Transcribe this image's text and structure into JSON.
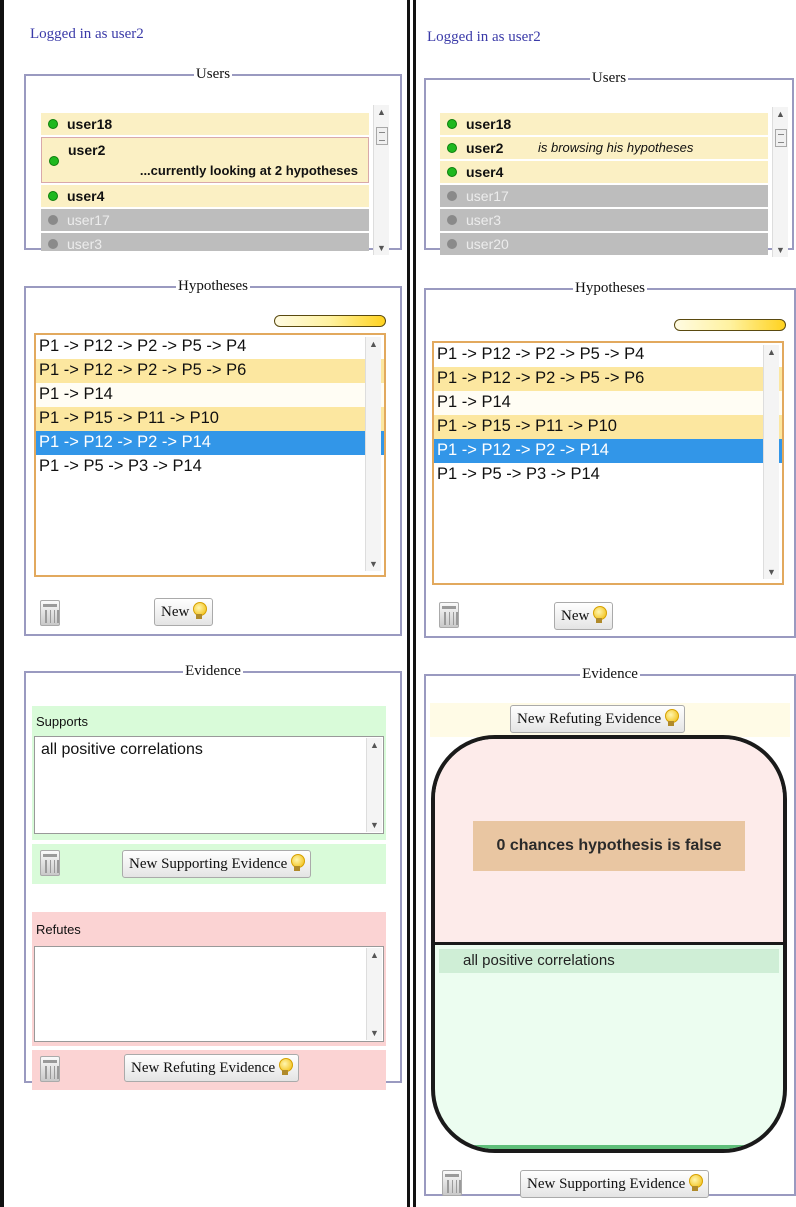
{
  "left": {
    "login": "Logged in as user2",
    "users": {
      "legend": "Users",
      "list": [
        {
          "name": "user18",
          "online": true,
          "status": ""
        },
        {
          "name": "user2",
          "online": true,
          "status": "...currently looking at 2 hypotheses"
        },
        {
          "name": "user4",
          "online": true,
          "status": ""
        },
        {
          "name": "user17",
          "online": false,
          "status": ""
        },
        {
          "name": "user3",
          "online": false,
          "status": ""
        }
      ]
    },
    "hypotheses": {
      "legend": "Hypotheses",
      "items": [
        "P1 -> P12 -> P2 -> P5 -> P4",
        "P1 -> P12 -> P2 -> P5 -> P6",
        "P1 -> P14",
        "P1 -> P15 -> P11 -> P10",
        "P1 -> P12 -> P2 -> P14",
        "P1 -> P5 -> P3 -> P14"
      ],
      "new_label": "New"
    },
    "evidence": {
      "legend": "Evidence",
      "supports_label": "Supports",
      "supports_items": [
        "all positive correlations"
      ],
      "new_supporting_label": "New Supporting Evidence",
      "refutes_label": "Refutes",
      "new_refuting_label": "New Refuting Evidence"
    }
  },
  "right": {
    "login": "Logged in as user2",
    "users": {
      "legend": "Users",
      "list": [
        {
          "name": "user18",
          "online": true,
          "status": ""
        },
        {
          "name": "user2",
          "online": true,
          "status": "is browsing his hypotheses"
        },
        {
          "name": "user4",
          "online": true,
          "status": ""
        },
        {
          "name": "user17",
          "online": false,
          "status": ""
        },
        {
          "name": "user3",
          "online": false,
          "status": ""
        },
        {
          "name": "user20",
          "online": false,
          "status": ""
        }
      ]
    },
    "hypotheses": {
      "legend": "Hypotheses",
      "items": [
        "P1 -> P12 -> P2 -> P5 -> P4",
        "P1 -> P12 -> P2 -> P5 -> P6",
        "P1 -> P14",
        "P1 -> P15 -> P11 -> P10",
        "P1 -> P12 -> P2 -> P14",
        "P1 -> P5 -> P3 -> P14"
      ],
      "new_label": "New"
    },
    "evidence": {
      "legend": "Evidence",
      "new_refuting_label": "New Refuting Evidence",
      "chance_text": "0 chances hypothesis is false",
      "supporting_item": "all positive correlations",
      "new_supporting_label": "New Supporting Evidence"
    }
  },
  "colors": {
    "online_row": "#fbf0c4",
    "offline_row": "#bdbdbd",
    "online_dot": "#1fb81f",
    "selected_hypothesis": "#3296e8",
    "highlight_hypothesis": "#fce7a0",
    "supports_bg": "#d9fbd9",
    "refutes_bg": "#fbd3d3"
  },
  "icons": [
    "trash-icon",
    "lightbulb-icon",
    "status-dot-icon",
    "scroll-up-icon",
    "scroll-down-icon"
  ]
}
